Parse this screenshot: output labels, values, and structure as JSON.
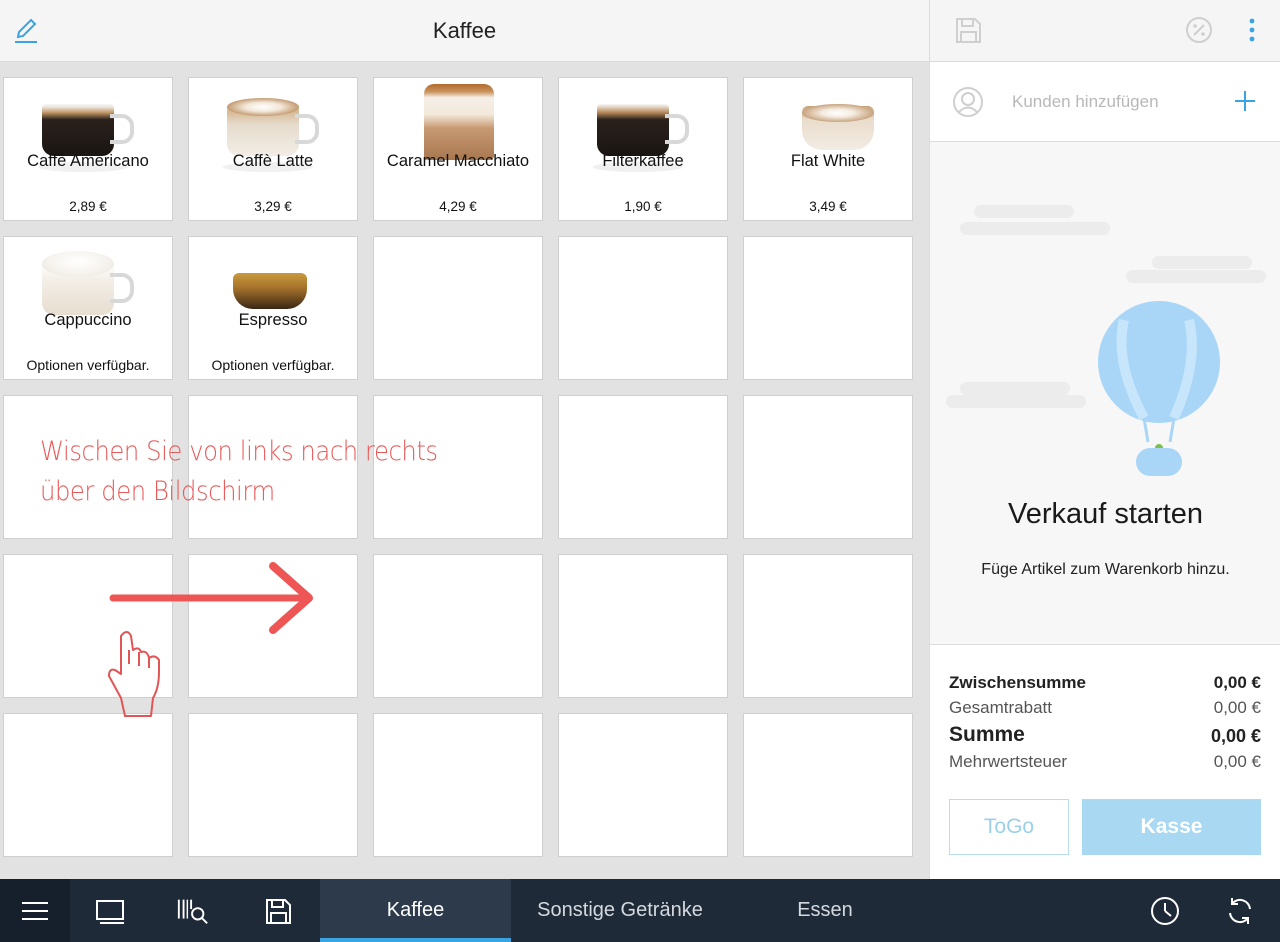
{
  "header": {
    "title": "Kaffee"
  },
  "products": [
    {
      "name": "Caffè Americano",
      "price": "2,89 €",
      "cup": "americano"
    },
    {
      "name": "Caffè Latte",
      "price": "3,29 €",
      "cup": "latte"
    },
    {
      "name": "Caramel Macchiato",
      "price": "4,29 €",
      "cup": "macchiato"
    },
    {
      "name": "Filterkaffee",
      "price": "1,90 €",
      "cup": "filter"
    },
    {
      "name": "Flat White",
      "price": "3,49 €",
      "cup": "flatwhite"
    },
    {
      "name": "Cappuccino",
      "options": "Optionen verfügbar.",
      "cup": "cappuccino"
    },
    {
      "name": "Espresso",
      "options": "Optionen verfügbar.",
      "cup": "espresso"
    }
  ],
  "hint": {
    "line1": "Wischen Sie von links nach rechts",
    "line2": "über den Bildschirm"
  },
  "customer": {
    "placeholder": "Kunden hinzufügen"
  },
  "cart": {
    "empty_title": "Verkauf starten",
    "empty_subtitle": "Füge Artikel zum Warenkorb hinzu."
  },
  "totals": {
    "subtotal_label": "Zwischensumme",
    "subtotal_value": "0,00 €",
    "discount_label": "Gesamtrabatt",
    "discount_value": "0,00 €",
    "sum_label": "Summe",
    "sum_value": "0,00 €",
    "tax_label": "Mehrwertsteuer",
    "tax_value": "0,00 €"
  },
  "buttons": {
    "togo": "ToGo",
    "kasse": "Kasse"
  },
  "tabs": [
    {
      "label": "Kaffee",
      "active": true
    },
    {
      "label": "Sonstige Getränke",
      "active": false
    },
    {
      "label": "Essen",
      "active": false
    }
  ],
  "colors": {
    "accent": "#3aa4e3",
    "hint": "#e85a5a",
    "bottom_bar": "#1f2a38",
    "kasse": "#a8d8f2"
  }
}
